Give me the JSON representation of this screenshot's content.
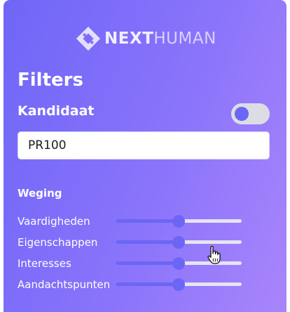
{
  "logo": {
    "brand_bold": "NEXT",
    "brand_light": "HUMAN"
  },
  "filters": {
    "title": "Filters"
  },
  "kandidaat": {
    "label": "Kandidaat",
    "toggle_on": false,
    "input_value": "PR100"
  },
  "weging": {
    "label": "Weging",
    "sliders": [
      {
        "label": "Vaardigheden",
        "value": 0.5
      },
      {
        "label": "Eigenschappen",
        "value": 0.5
      },
      {
        "label": "Interesses",
        "value": 0.5
      },
      {
        "label": "Aandachtspunten",
        "value": 0.5
      }
    ]
  },
  "colors": {
    "accent": "#6b66f5",
    "gradient_start": "#6f66f7",
    "gradient_end": "#a985fb",
    "track": "#e6e4ef"
  },
  "icons": {
    "logo": "nexthuman-logo-icon",
    "cursor": "hand-pointer-cursor-icon"
  }
}
